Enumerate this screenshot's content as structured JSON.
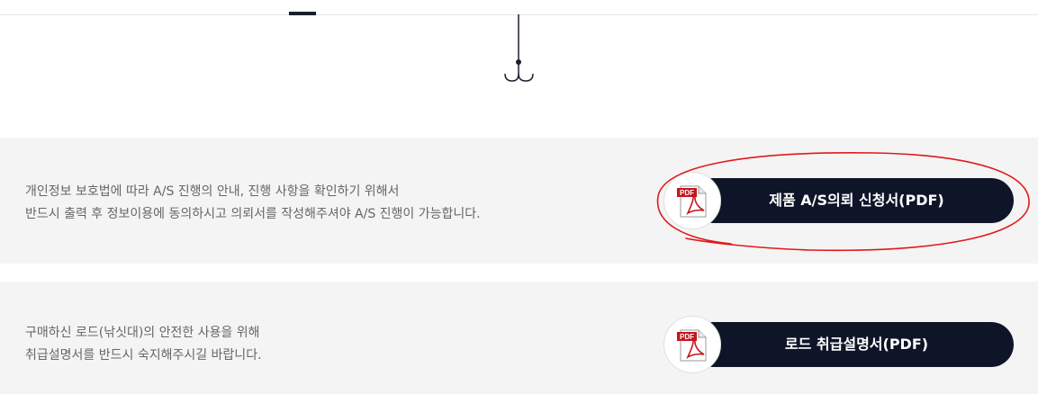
{
  "colors": {
    "page_bg": "#ffffff",
    "panel_bg": "#f4f4f4",
    "button_bg": "#0e1528",
    "button_text": "#ffffff",
    "body_text": "#666666",
    "annotation": "#e0191b",
    "pdf_icon": "#c4161c"
  },
  "sections": [
    {
      "lines": [
        "개인정보 보호법에 따라 A/S 진행의 안내, 진행 사항을 확인하기 위해서",
        "반드시 출력 후 정보이용에 동의하시고 의뢰서를 작성해주셔야 A/S 진행이 가능합니다."
      ],
      "button_label": "제품 A/S의뢰 신청서(PDF)",
      "icon": "pdf-file-icon",
      "icon_text": "PDF"
    },
    {
      "lines": [
        "구매하신 로드(낚싯대)의 안전한 사용을 위해",
        "취급설명서를 반드시 숙지해주시길 바랍니다."
      ],
      "button_label": "로드 취급설명서(PDF)",
      "icon": "pdf-file-icon",
      "icon_text": "PDF"
    }
  ]
}
